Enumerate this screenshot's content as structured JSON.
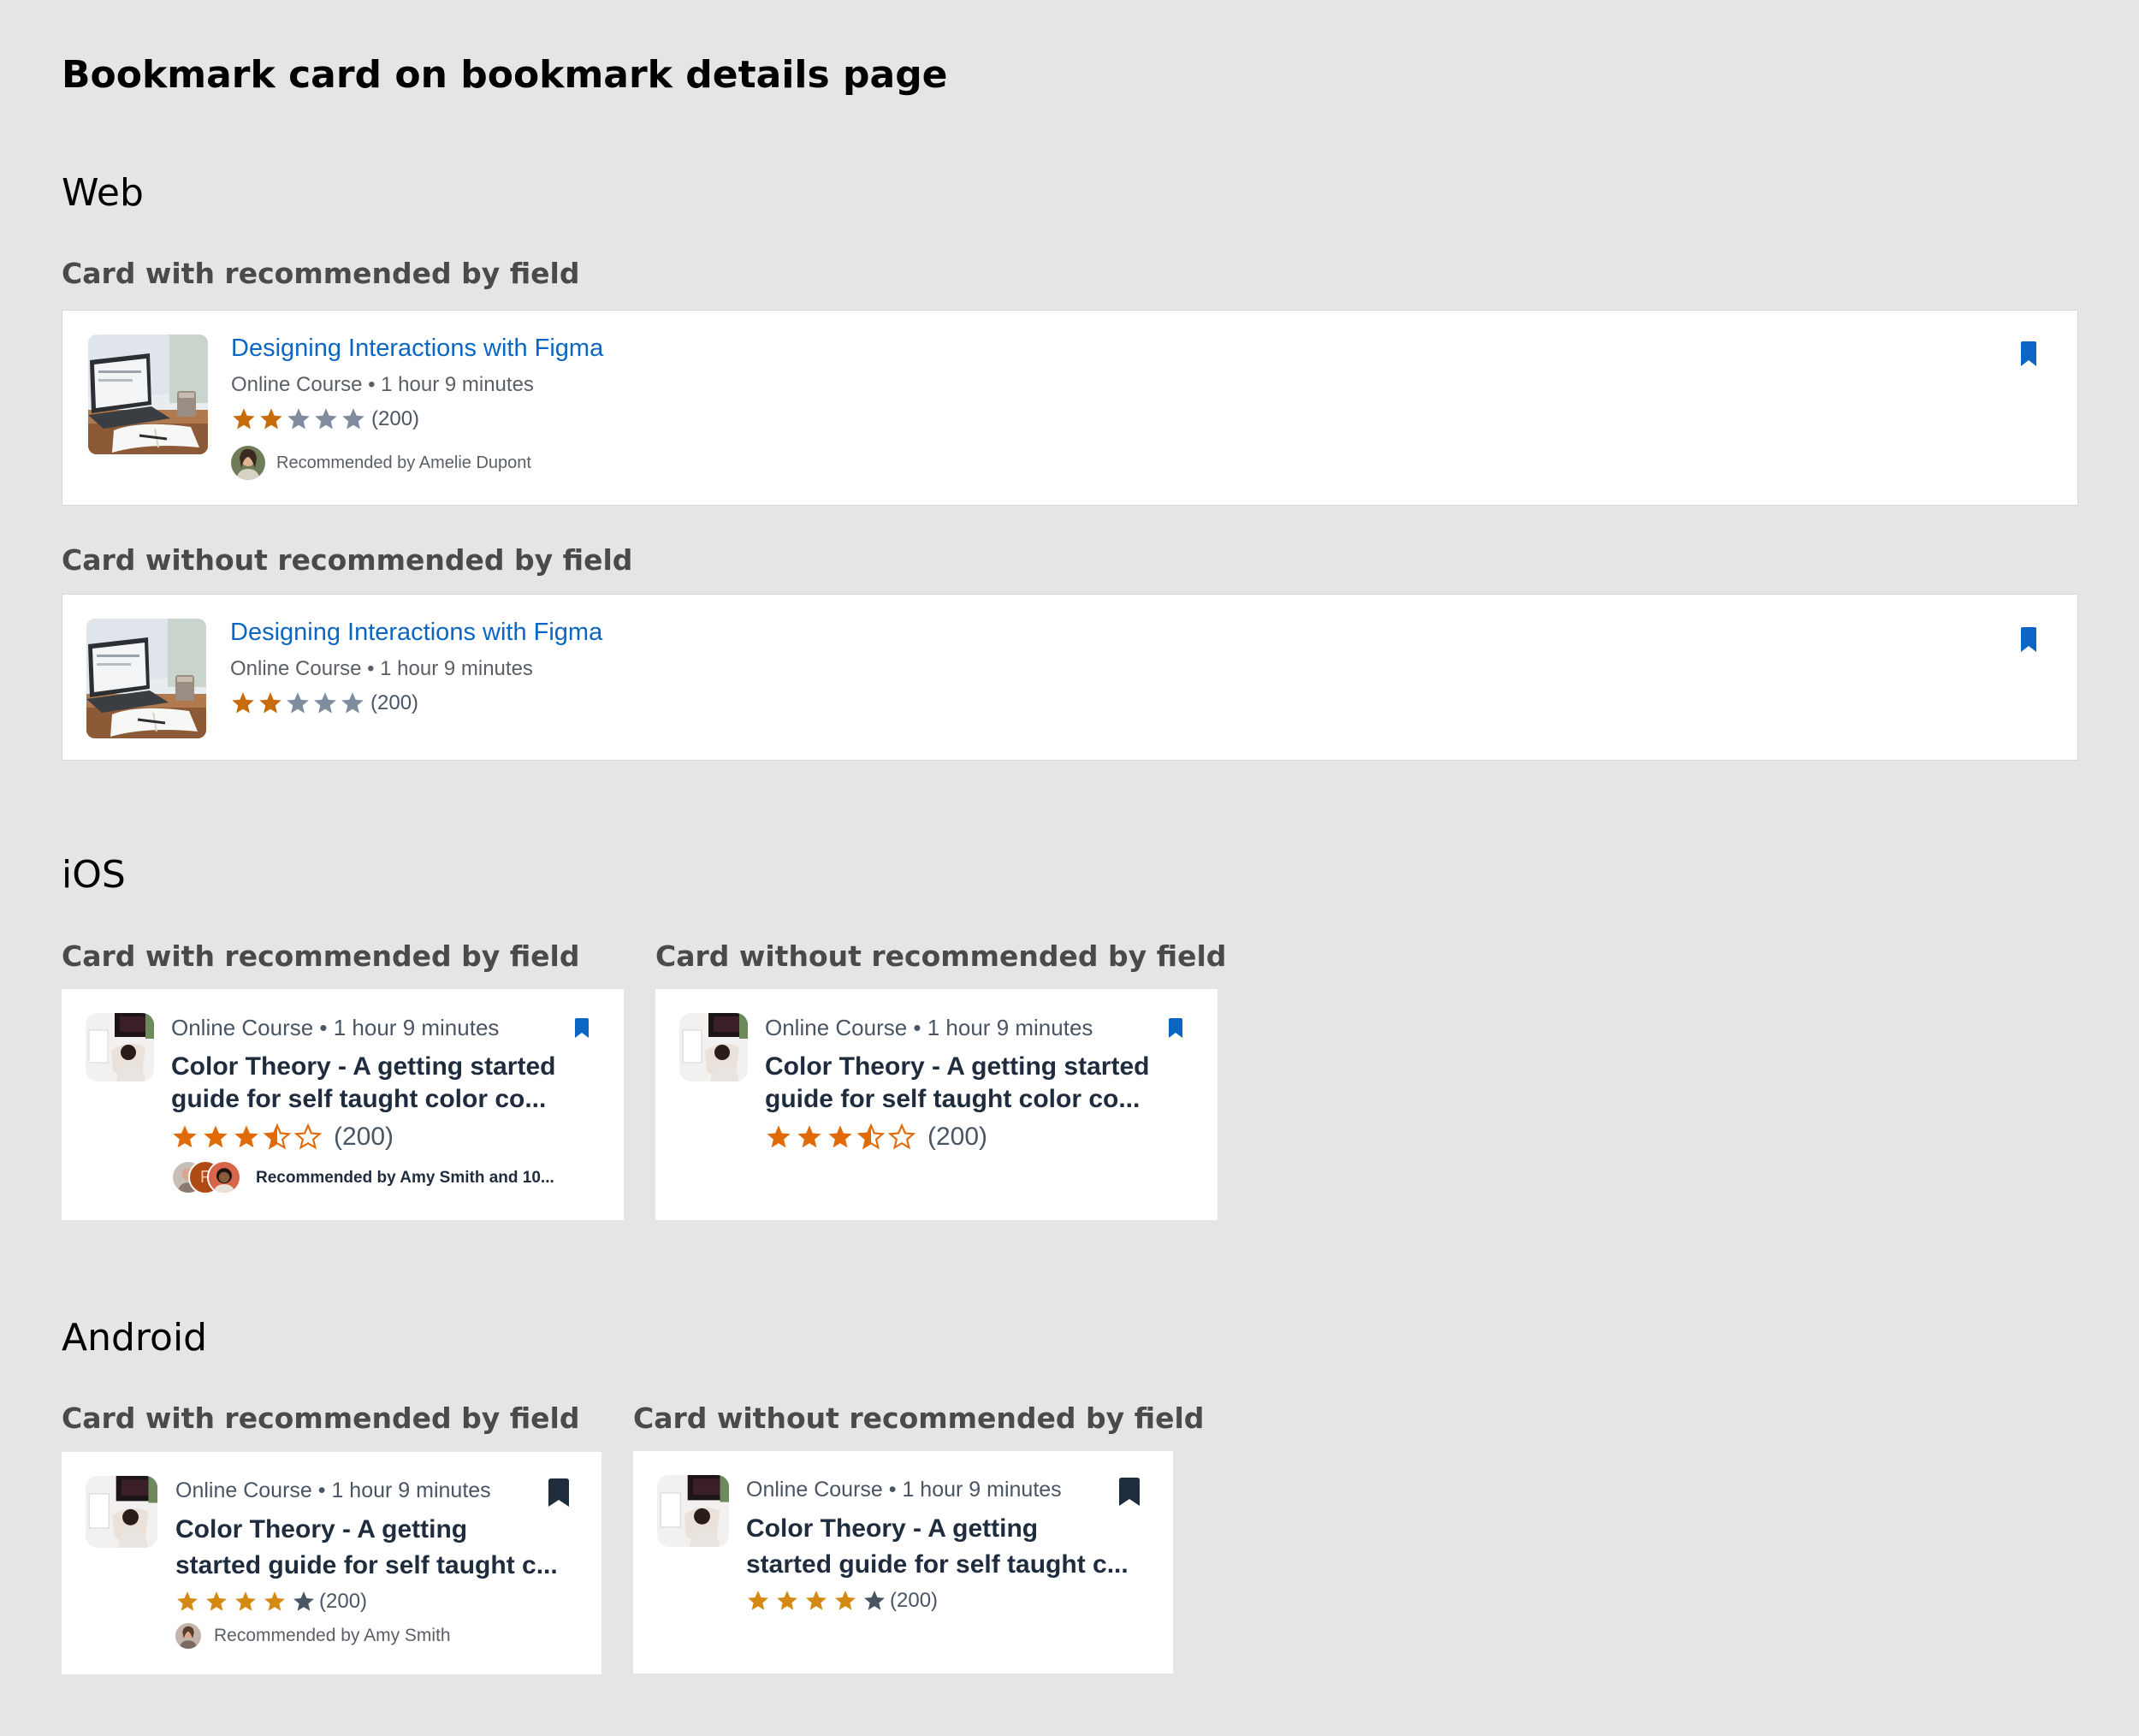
{
  "page": {
    "title": "Bookmark card on bookmark details page"
  },
  "colors": {
    "link": "#0a66c2",
    "star_filled_web": "#c86b0a",
    "star_filled_mobile": "#e06b06",
    "star_empty_web": "#7f8c9e",
    "bookmark_web": "#0a66c2",
    "bookmark_android": "#1f2c3e",
    "background": "#e5e5e5"
  },
  "web": {
    "heading": "Web",
    "with": {
      "label": "Card with recommended by field",
      "title": "Designing Interactions with Figma",
      "meta": "Online Course • 1 hour 9 minutes",
      "rating": 2,
      "max_rating": 5,
      "count": "(200)",
      "recommended": "Recommended by Amelie Dupont",
      "icon": "bookmark-filled-icon"
    },
    "without": {
      "label": "Card without recommended by field",
      "title": "Designing Interactions with Figma",
      "meta": "Online Course • 1 hour 9 minutes",
      "rating": 2,
      "max_rating": 5,
      "count": "(200)",
      "icon": "bookmark-filled-icon"
    }
  },
  "ios": {
    "heading": "iOS",
    "with": {
      "label": "Card with recommended by field",
      "meta": "Online Course • 1 hour 9 minutes",
      "title_line1": "Color Theory - A getting started",
      "title_line2": "guide for self taught color co...",
      "rating": 3.5,
      "max_rating": 5,
      "count": "(200)",
      "recommended": "Recommended by Amy Smith and 10...",
      "avatar_initial": "F",
      "icon": "bookmark-filled-icon"
    },
    "without": {
      "label": "Card without recommended by field",
      "meta": "Online Course • 1 hour 9 minutes",
      "title_line1": "Color Theory - A getting started",
      "title_line2": "guide for self taught color co...",
      "rating": 3.5,
      "max_rating": 5,
      "count": "(200)",
      "icon": "bookmark-filled-icon"
    }
  },
  "android": {
    "heading": "Android",
    "with": {
      "label": "Card with recommended by field",
      "meta": "Online Course • 1 hour 9 minutes",
      "title_line1": "Color Theory - A getting",
      "title_line2": "started guide for self taught c...",
      "rating": 4,
      "max_rating": 5,
      "count": "(200)",
      "recommended": "Recommended by Amy Smith",
      "icon": "bookmark-filled-icon"
    },
    "without": {
      "label": "Card without recommended by field",
      "meta": "Online Course • 1 hour 9 minutes",
      "title_line1": "Color Theory - A getting",
      "title_line2": "started guide for self taught c...",
      "rating": 4,
      "max_rating": 5,
      "count": "(200)",
      "icon": "bookmark-filled-icon"
    }
  }
}
